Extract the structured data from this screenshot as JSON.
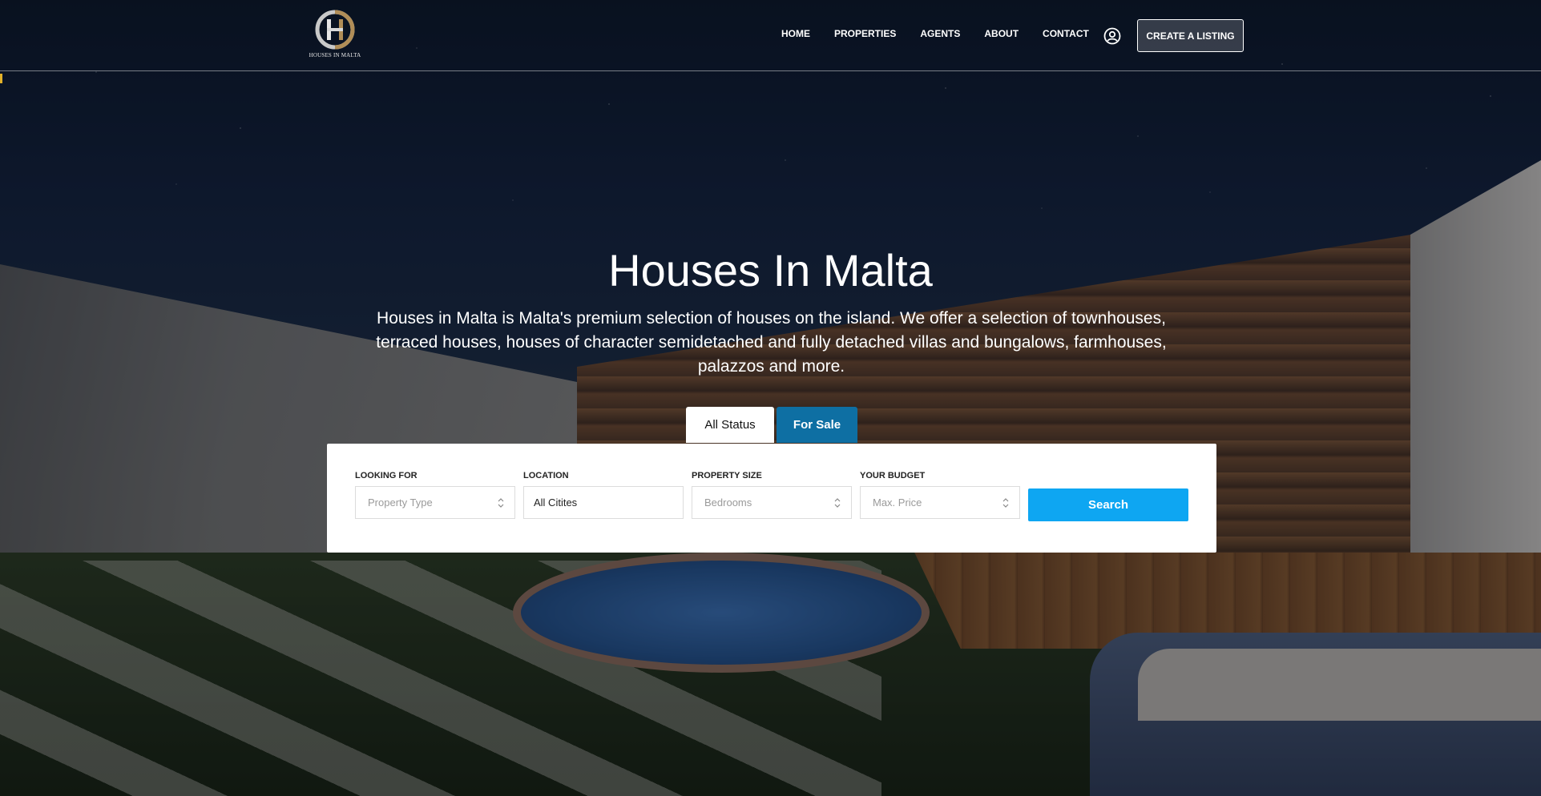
{
  "brand": {
    "logo_letter": "H",
    "logo_text": "HOUSES IN MALTA",
    "accent_gold": "#b08d57",
    "accent_blue": "#0ea6f2",
    "tab_blue": "#0e6fa3"
  },
  "nav": {
    "items": [
      "HOME",
      "PROPERTIES",
      "AGENTS",
      "ABOUT",
      "CONTACT"
    ],
    "user_icon": "user-circle-icon",
    "cta_label": "CREATE A LISTING"
  },
  "hero": {
    "title": "Houses In Malta",
    "subtitle": "Houses in Malta is Malta's premium selection of houses on the island. We offer a selection of townhouses, terraced houses, houses of character semidetached and fully detached villas and bungalows, farmhouses, palazzos and more."
  },
  "search": {
    "tabs": [
      "All Status",
      "For Sale"
    ],
    "active_tab": "All Status",
    "fields": [
      {
        "label": "LOOKING FOR",
        "placeholder": "Property Type",
        "has_chevrons": true
      },
      {
        "label": "LOCATION",
        "value": "All Citites",
        "has_chevrons": false
      },
      {
        "label": "PROPERTY SIZE",
        "placeholder": "Bedrooms",
        "has_chevrons": true
      },
      {
        "label": "YOUR BUDGET",
        "placeholder": "Max. Price",
        "has_chevrons": true
      }
    ],
    "button_label": "Search"
  }
}
